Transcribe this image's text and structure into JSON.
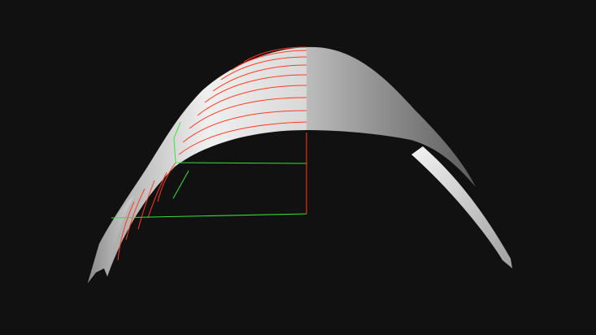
{
  "scene": {
    "background_color": "#111111",
    "surface_light_color": "#f2f2f2",
    "surface_mid_color": "#b8b8b8",
    "surface_dark_color": "#5a5a5a",
    "isoline_color": "#ff3b1f",
    "guide_color": "#33e633"
  }
}
